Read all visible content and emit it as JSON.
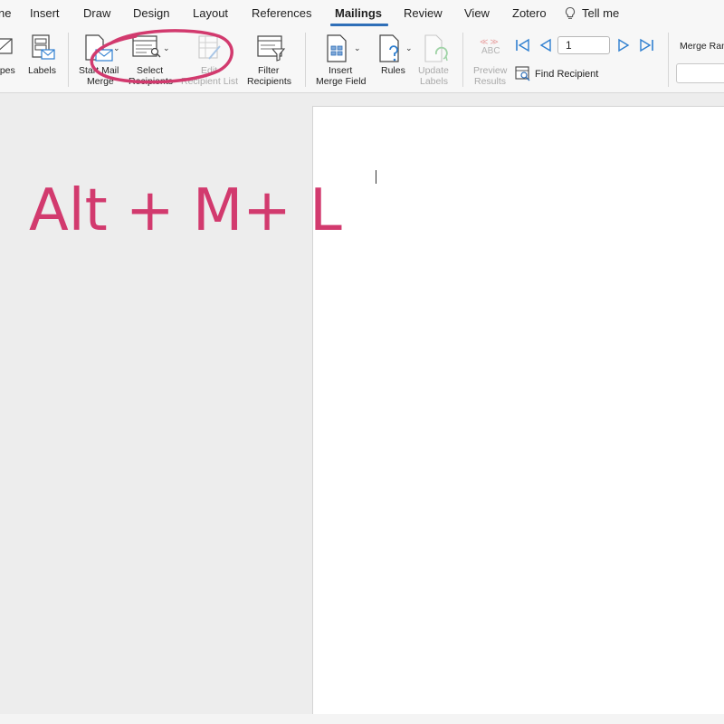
{
  "tabs": [
    {
      "label": "ne",
      "active": false
    },
    {
      "label": "Insert",
      "active": false
    },
    {
      "label": "Draw",
      "active": false
    },
    {
      "label": "Design",
      "active": false
    },
    {
      "label": "Layout",
      "active": false
    },
    {
      "label": "References",
      "active": false
    },
    {
      "label": "Mailings",
      "active": true
    },
    {
      "label": "Review",
      "active": false
    },
    {
      "label": "View",
      "active": false
    },
    {
      "label": "Zotero",
      "active": false
    }
  ],
  "tell_me": "Tell me",
  "ribbon": {
    "envelopes": {
      "label": "opes",
      "icon": "envelope-icon"
    },
    "labels": {
      "label": "Labels",
      "icon": "labels-icon"
    },
    "start_mail_merge": {
      "line1": "Start Mail",
      "line2": "Merge",
      "icon": "mail-merge-icon"
    },
    "select_recipients": {
      "line1": "Select",
      "line2": "Recipients",
      "icon": "recipients-list-icon"
    },
    "edit_recipient_list": {
      "line1": "Edit",
      "line2": "Recipient List",
      "icon": "edit-list-icon",
      "disabled": true
    },
    "filter_recipients": {
      "line1": "Filter",
      "line2": "Recipients",
      "icon": "filter-icon"
    },
    "insert_merge_field": {
      "line1": "Insert",
      "line2": "Merge Field",
      "icon": "merge-field-icon"
    },
    "rules": {
      "label": "Rules",
      "icon": "rules-icon"
    },
    "update_labels": {
      "line1": "Update",
      "line2": "Labels",
      "icon": "update-labels-icon",
      "disabled": true
    },
    "preview_results": {
      "line1": "Preview",
      "line2": "Results",
      "icon": "preview-abc-icon",
      "icon_text": "ABC",
      "disabled": true
    },
    "record_number": "1",
    "find_recipient": "Find Recipient",
    "merge_range_label": "Merge Ran"
  },
  "annotation": {
    "shortcut_text": "Alt + M+ L",
    "color": "#d23a6e"
  },
  "colors": {
    "accent_blue": "#2f6fb8",
    "annotation_pink": "#d23a6e"
  }
}
